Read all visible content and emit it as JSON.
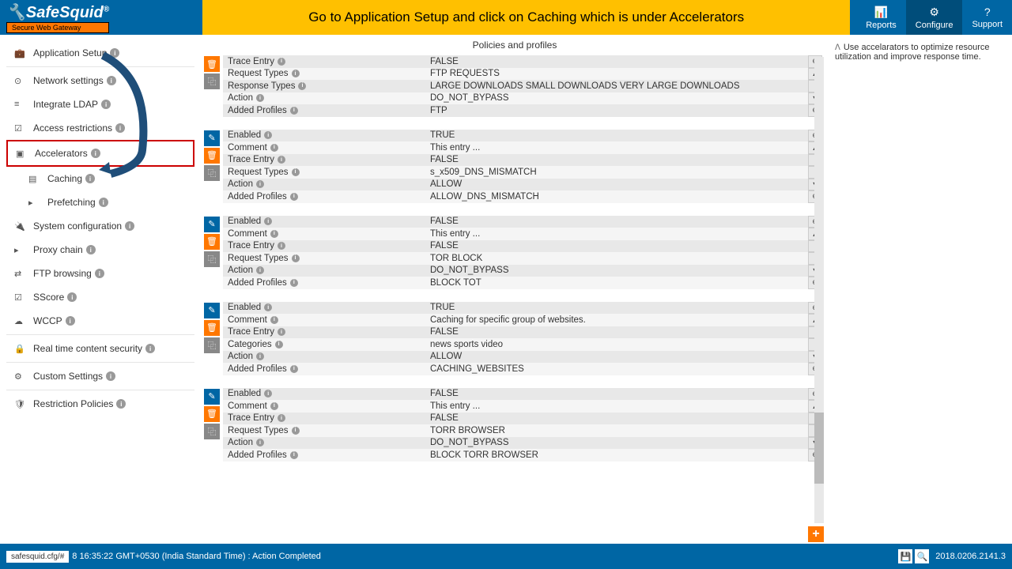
{
  "logo": {
    "name": "SafeSquid",
    "reg": "®",
    "sub": "Secure Web Gateway"
  },
  "banner": "Go to Application Setup and click on Caching which is under Accelerators",
  "nav": [
    {
      "label": "Reports",
      "icon": "📊"
    },
    {
      "label": "Configure",
      "icon": "⚙"
    },
    {
      "label": "Support",
      "icon": "?"
    }
  ],
  "sidebar": [
    {
      "label": "Application Setup",
      "icon": "💼"
    },
    {
      "label": "Network settings",
      "icon": "⊙"
    },
    {
      "label": "Integrate LDAP",
      "icon": "≡"
    },
    {
      "label": "Access restrictions",
      "icon": "☑"
    },
    {
      "label": "Accelerators",
      "icon": "▣"
    },
    {
      "label": "Caching",
      "icon": "▤",
      "sub": true
    },
    {
      "label": "Prefetching",
      "icon": "▸",
      "sub": true
    },
    {
      "label": "System configuration",
      "icon": "🔌"
    },
    {
      "label": "Proxy chain",
      "icon": "▸"
    },
    {
      "label": "FTP browsing",
      "icon": "⇄"
    },
    {
      "label": "SScore",
      "icon": "☑"
    },
    {
      "label": "WCCP",
      "icon": "☁"
    },
    {
      "label": "Real time content security",
      "icon": "🔒"
    },
    {
      "label": "Custom Settings",
      "icon": "⚙"
    },
    {
      "label": "Restriction Policies",
      "icon": "🛡"
    }
  ],
  "content_title": "Policies and profiles",
  "help_text": "Use accelarators to optimize resource utilization and improve response time.",
  "groups": [
    {
      "rows": [
        {
          "label": "Trace Entry",
          "value": "FALSE"
        },
        {
          "label": "Request Types",
          "value": "FTP REQUESTS"
        },
        {
          "label": "Response Types",
          "value": "LARGE DOWNLOADS  SMALL DOWNLOADS  VERY LARGE DOWNLOADS"
        },
        {
          "label": "Action",
          "value": "DO_NOT_BYPASS"
        },
        {
          "label": "Added Profiles",
          "value": "FTP"
        }
      ],
      "partial": true
    },
    {
      "rows": [
        {
          "label": "Enabled",
          "value": "TRUE"
        },
        {
          "label": "Comment",
          "value": "This entry ..."
        },
        {
          "label": "Trace Entry",
          "value": "FALSE"
        },
        {
          "label": "Request Types",
          "value": "s_x509_DNS_MISMATCH"
        },
        {
          "label": "Action",
          "value": "ALLOW"
        },
        {
          "label": "Added Profiles",
          "value": "ALLOW_DNS_MISMATCH"
        }
      ]
    },
    {
      "rows": [
        {
          "label": "Enabled",
          "value": "FALSE"
        },
        {
          "label": "Comment",
          "value": "This entry ..."
        },
        {
          "label": "Trace Entry",
          "value": "FALSE"
        },
        {
          "label": "Request Types",
          "value": "TOR BLOCK"
        },
        {
          "label": "Action",
          "value": "DO_NOT_BYPASS"
        },
        {
          "label": "Added Profiles",
          "value": "BLOCK TOT"
        }
      ]
    },
    {
      "rows": [
        {
          "label": "Enabled",
          "value": "TRUE"
        },
        {
          "label": "Comment",
          "value": "Caching for specific group of websites."
        },
        {
          "label": "Trace Entry",
          "value": "FALSE"
        },
        {
          "label": "Categories",
          "value": "news  sports  video"
        },
        {
          "label": "Action",
          "value": "ALLOW"
        },
        {
          "label": "Added Profiles",
          "value": "CACHING_WEBSITES"
        }
      ]
    },
    {
      "rows": [
        {
          "label": "Enabled",
          "value": "FALSE"
        },
        {
          "label": "Comment",
          "value": "This entry ..."
        },
        {
          "label": "Trace Entry",
          "value": "FALSE"
        },
        {
          "label": "Request Types",
          "value": "TORR BROWSER"
        },
        {
          "label": "Action",
          "value": "DO_NOT_BYPASS"
        },
        {
          "label": "Added Profiles",
          "value": "BLOCK TORR BROWSER"
        }
      ]
    }
  ],
  "footer": {
    "url": "safesquid.cfg/#",
    "status": "8 16:35:22 GMT+0530 (India Standard Time) : Action Completed",
    "version": "2018.0206.2141.3"
  }
}
